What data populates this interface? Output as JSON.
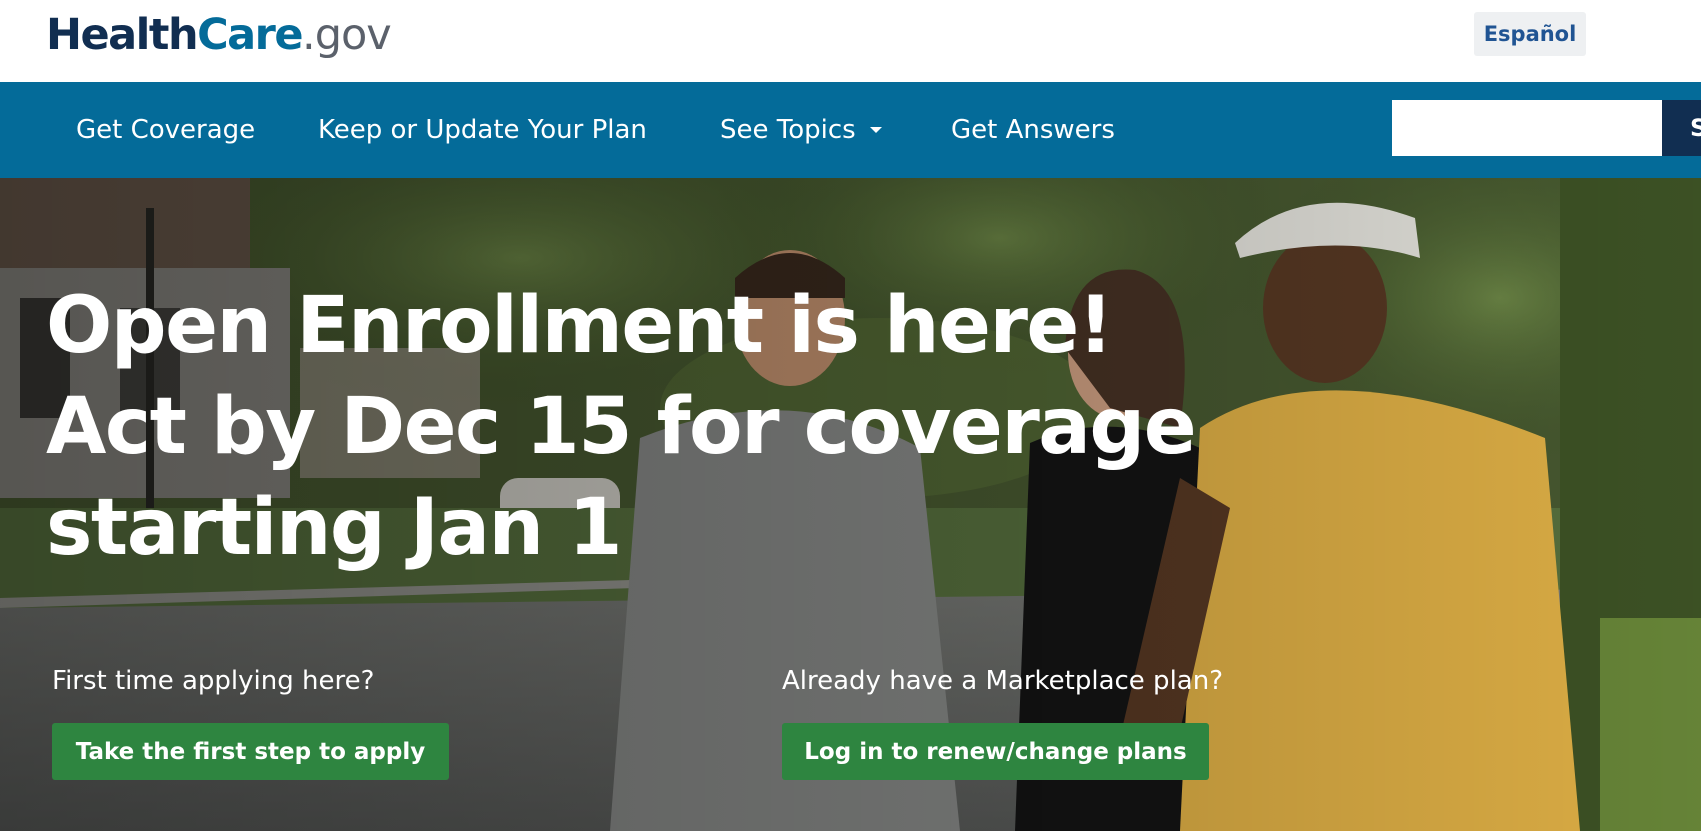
{
  "header": {
    "logo": {
      "part1": "Health",
      "part2": "Care",
      "part3": ".gov"
    },
    "language_button": "Español"
  },
  "nav": {
    "items": [
      {
        "label": "Get Coverage"
      },
      {
        "label": "Keep or Update Your Plan"
      },
      {
        "label": "See Topics",
        "has_dropdown": true
      },
      {
        "label": "Get Answers"
      }
    ],
    "search": {
      "placeholder": "",
      "value": "",
      "button_label": "Search"
    }
  },
  "hero": {
    "title_lines": [
      "Open Enrollment is here!",
      "Act by Dec 15 for coverage",
      "starting Jan 1"
    ],
    "left": {
      "prompt": "First time applying here?",
      "button": "Take the first step to apply"
    },
    "right": {
      "prompt": "Already have a Marketplace plan?",
      "button": "Log in to renew/change plans"
    }
  },
  "colors": {
    "nav_bg": "#046b99",
    "logo_dark": "#112e51",
    "logo_accent": "#046b99",
    "cta_green": "#2e8540",
    "lang_bg": "#eef0f2"
  }
}
